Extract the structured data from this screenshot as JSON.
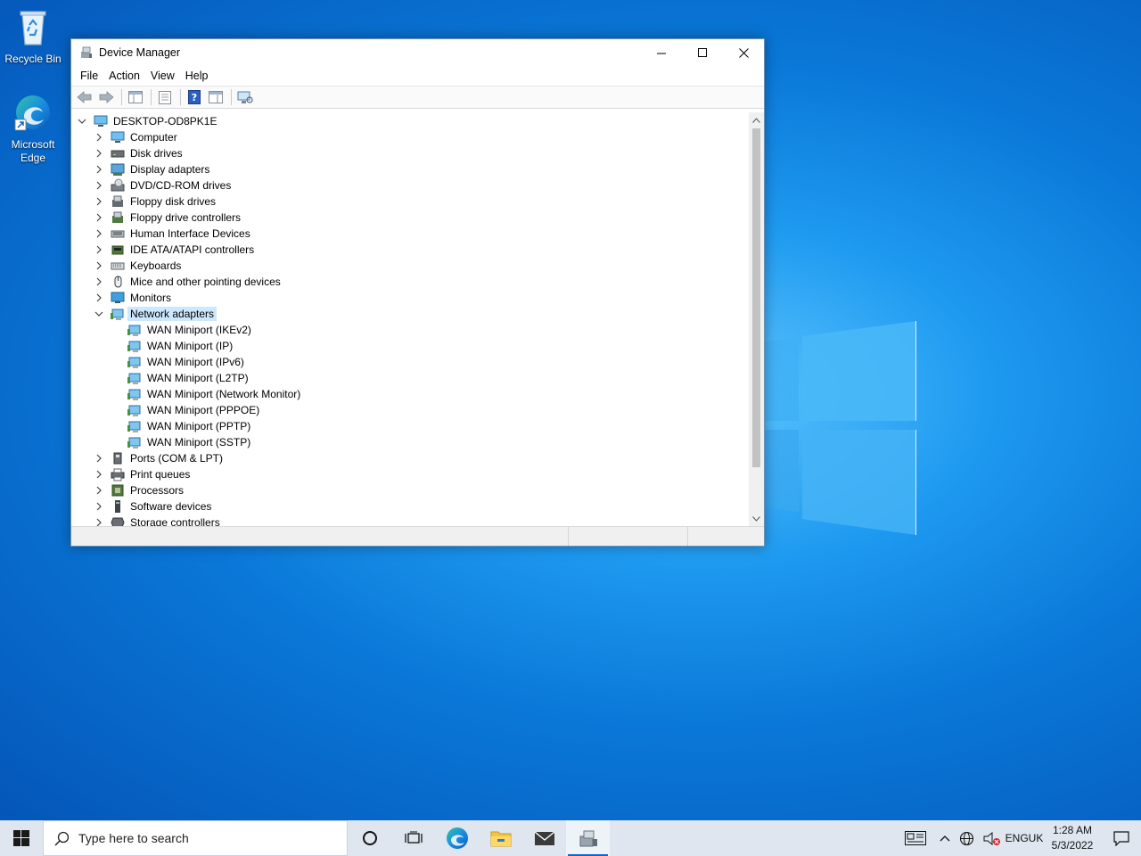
{
  "desktop": {
    "icons": [
      {
        "label": "Recycle Bin"
      },
      {
        "label": "Microsoft Edge"
      }
    ]
  },
  "window": {
    "title": "Device Manager",
    "menu": [
      "File",
      "Action",
      "View",
      "Help"
    ]
  },
  "tree": {
    "root": "DESKTOP-OD8PK1E",
    "categories": [
      {
        "label": "Computer",
        "icon": "computer-icon"
      },
      {
        "label": "Disk drives",
        "icon": "disk-drive-icon"
      },
      {
        "label": "Display adapters",
        "icon": "display-adapter-icon"
      },
      {
        "label": "DVD/CD-ROM drives",
        "icon": "dvd-drive-icon"
      },
      {
        "label": "Floppy disk drives",
        "icon": "floppy-drive-icon"
      },
      {
        "label": "Floppy drive controllers",
        "icon": "floppy-controller-icon"
      },
      {
        "label": "Human Interface Devices",
        "icon": "hid-icon"
      },
      {
        "label": "IDE ATA/ATAPI controllers",
        "icon": "ide-controller-icon"
      },
      {
        "label": "Keyboards",
        "icon": "keyboard-icon"
      },
      {
        "label": "Mice and other pointing devices",
        "icon": "mouse-icon"
      },
      {
        "label": "Monitors",
        "icon": "monitor-icon"
      },
      {
        "label": "Network adapters",
        "icon": "network-adapter-icon",
        "expanded": true,
        "selected": true
      },
      {
        "label": "Ports (COM & LPT)",
        "icon": "port-icon"
      },
      {
        "label": "Print queues",
        "icon": "printer-icon"
      },
      {
        "label": "Processors",
        "icon": "processor-icon"
      },
      {
        "label": "Software devices",
        "icon": "software-device-icon"
      },
      {
        "label": "Storage controllers",
        "icon": "storage-controller-icon"
      }
    ],
    "network_children": [
      "WAN Miniport (IKEv2)",
      "WAN Miniport (IP)",
      "WAN Miniport (IPv6)",
      "WAN Miniport (L2TP)",
      "WAN Miniport (Network Monitor)",
      "WAN Miniport (PPPOE)",
      "WAN Miniport (PPTP)",
      "WAN Miniport (SSTP)"
    ]
  },
  "taskbar": {
    "search_placeholder": "Type here to search",
    "language": "ENG",
    "region": "UK",
    "time": "1:28 AM",
    "date": "5/3/2022"
  },
  "colors": {
    "accent": "#0a6ad1",
    "selection": "#cce8ff",
    "desktop": "#0a78d8"
  }
}
